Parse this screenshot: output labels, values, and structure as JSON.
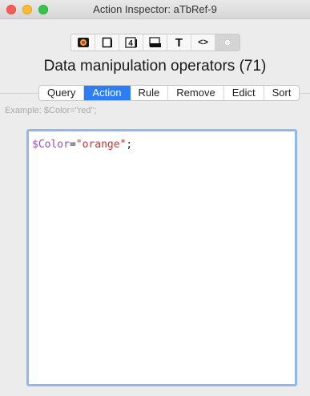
{
  "window": {
    "title": "Action Inspector: aTbRef-9"
  },
  "toolbar": {
    "buttons": [
      {
        "name": "general-icon",
        "glyph": "🟫"
      },
      {
        "name": "note-icon",
        "glyph": "▢"
      },
      {
        "name": "number-icon",
        "glyph": "4"
      },
      {
        "name": "shadow-icon",
        "glyph": "■"
      },
      {
        "name": "text-icon",
        "glyph": "T"
      },
      {
        "name": "code-icon",
        "glyph": "<>"
      },
      {
        "name": "action-gear-icon",
        "glyph": "✲"
      }
    ]
  },
  "heading": "Data manipulation operators (71)",
  "tabs": [
    "Query",
    "Action",
    "Rule",
    "Remove",
    "Edict",
    "Sort"
  ],
  "active_tab": "Action",
  "example_text": "Example: $Color=\"red\";",
  "editor": {
    "attribute": "$Color",
    "operator": "=",
    "string": "\"orange\"",
    "terminator": ";"
  },
  "colors": {
    "accent": "#2c7df6",
    "attribute": "#a044c8",
    "string": "#d0312d",
    "focus_ring": "#8fb8f0"
  }
}
